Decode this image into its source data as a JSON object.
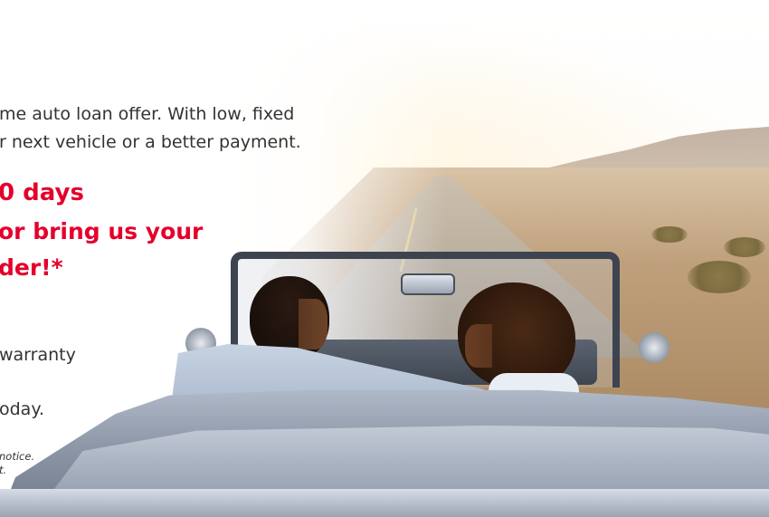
{
  "intro": {
    "line1": "me auto loan offer. With low, fixed",
    "line2": "r next vehicle or a better payment."
  },
  "headline": {
    "line1": "0 days",
    "line2": "or bring us your",
    "line3": "der!*"
  },
  "benefits": {
    "line1": "warranty",
    "line2": "oday."
  },
  "disclaimer": {
    "line1": "notice.",
    "line2": "t."
  },
  "colors": {
    "accent": "#e4002b",
    "body_text": "#333333"
  },
  "image": {
    "subject": "couple driving a convertible car on a desert road at sunset"
  }
}
